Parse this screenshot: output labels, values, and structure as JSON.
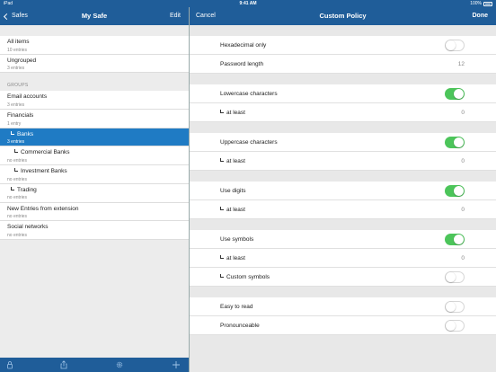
{
  "status": {
    "device": "iPad",
    "time": "9:41 AM",
    "battery": "100%"
  },
  "left_nav": {
    "back_label": "Safes",
    "title": "My Safe",
    "edit_label": "Edit"
  },
  "right_nav": {
    "cancel_label": "Cancel",
    "title": "Custom Policy",
    "done_label": "Done"
  },
  "top_items": [
    {
      "title": "All items",
      "sub": "10 entries"
    },
    {
      "title": "Ungrouped",
      "sub": "3 entries"
    }
  ],
  "groups_header": "GROUPS",
  "groups": [
    {
      "title": "Email accounts",
      "sub": "3 entries",
      "indent": 0,
      "selected": false
    },
    {
      "title": "Financials",
      "sub": "1 entry",
      "indent": 0,
      "selected": false
    },
    {
      "title": "Banks",
      "sub": "3 entries",
      "indent": 1,
      "selected": true
    },
    {
      "title": "Commercial Banks",
      "sub": "no entries",
      "indent": 2,
      "selected": false
    },
    {
      "title": "Investment Banks",
      "sub": "no entries",
      "indent": 2,
      "selected": false
    },
    {
      "title": "Trading",
      "sub": "no entries",
      "indent": 1,
      "selected": false
    },
    {
      "title": "New Entries from extension",
      "sub": "no entries",
      "indent": 0,
      "selected": false
    },
    {
      "title": "Social networks",
      "sub": "no entries",
      "indent": 0,
      "selected": false
    }
  ],
  "toolbar_icons": [
    "lock-icon",
    "share-icon",
    "gear-icon",
    "add-icon"
  ],
  "policy": {
    "hex_only": {
      "label": "Hexadecimal only",
      "on": false
    },
    "length": {
      "label": "Password length",
      "value": "12"
    },
    "lowercase": {
      "label": "Lowercase characters",
      "on": true,
      "atleast_label": "at least",
      "atleast_value": "0"
    },
    "uppercase": {
      "label": "Uppercase characters",
      "on": true,
      "atleast_label": "at least",
      "atleast_value": "0"
    },
    "digits": {
      "label": "Use digits",
      "on": true,
      "atleast_label": "at least",
      "atleast_value": "0"
    },
    "symbols": {
      "label": "Use symbols",
      "on": true,
      "atleast_label": "at least",
      "atleast_value": "0",
      "custom_label": "Custom symbols",
      "custom_on": false
    },
    "easy_to_read": {
      "label": "Easy to read",
      "on": false
    },
    "pronounceable": {
      "label": "Pronounceable",
      "on": false
    }
  },
  "colors": {
    "bar": "#1f5d99",
    "selection": "#1f7bc4",
    "toggle_on": "#4cc55a"
  }
}
